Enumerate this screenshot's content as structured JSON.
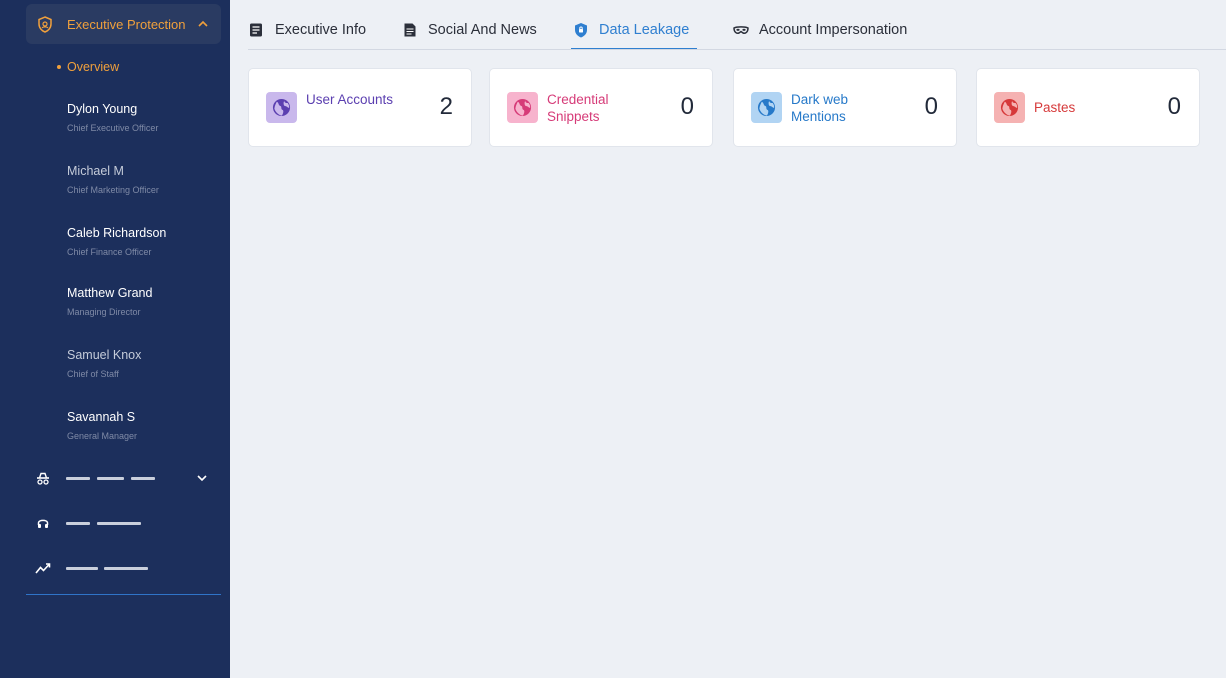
{
  "sidebar": {
    "section_title": "Executive Protection",
    "overview_label": "Overview",
    "executives": [
      {
        "name": "Dylon Young",
        "role": "Chief Executive Officer"
      },
      {
        "name": "Michael M",
        "role": "Chief Marketing Officer"
      },
      {
        "name": "Caleb Richardson",
        "role": "Chief Finance Officer"
      },
      {
        "name": "Matthew Grand",
        "role": "Managing Director"
      },
      {
        "name": "Samuel Knox",
        "role": "Chief of Staff"
      },
      {
        "name": "Savannah S",
        "role": "General Manager"
      }
    ]
  },
  "tabs": [
    {
      "label": "Executive Info",
      "icon": "document-icon"
    },
    {
      "label": "Social And News",
      "icon": "news-icon"
    },
    {
      "label": "Data Leakage",
      "icon": "shield-icon",
      "active": true
    },
    {
      "label": "Account Impersonation",
      "icon": "mask-icon"
    }
  ],
  "cards": [
    {
      "label": "User Accounts",
      "count": "2",
      "color": "#5b3fb0",
      "bg": "#c9b8ec"
    },
    {
      "label": "Credential Snippets",
      "count": "0",
      "color": "#d63b78",
      "bg": "#f7b3cd"
    },
    {
      "label": "Dark web Mentions",
      "count": "0",
      "color": "#2679c9",
      "bg": "#b1d4f3"
    },
    {
      "label": "Pastes",
      "count": "0",
      "color": "#d6393a",
      "bg": "#f5b2b2"
    }
  ],
  "colors": {
    "sidebar": "#1c2f5c",
    "accent": "#f0a03c",
    "active_tab": "#2f7fd0"
  }
}
